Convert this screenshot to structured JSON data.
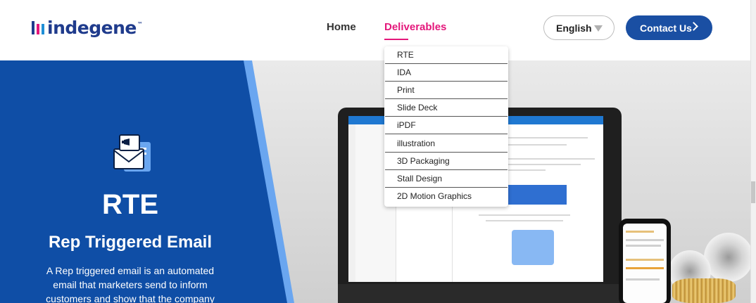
{
  "header": {
    "logo_text": "indegene",
    "nav": {
      "home": "Home",
      "deliverables": "Deliverables"
    },
    "language": {
      "selected": "English"
    },
    "contact_label": "Contact Us"
  },
  "dropdown": {
    "items": [
      "RTE",
      "IDA",
      "Print",
      "Slide Deck",
      "iPDF",
      "illustration",
      "3D Packaging",
      "Stall Design",
      "2D Motion Graphics"
    ]
  },
  "hero": {
    "title": "RTE",
    "subtitle": "Rep Triggered Email",
    "description": "A Rep triggered email is an automated email that marketers send to inform customers and show that the company"
  },
  "colors": {
    "brand_blue": "#1a4fa3",
    "accent_pink": "#e4177b",
    "panel_blue": "#0f4ea6",
    "stripe_blue": "#6aa6f0"
  }
}
